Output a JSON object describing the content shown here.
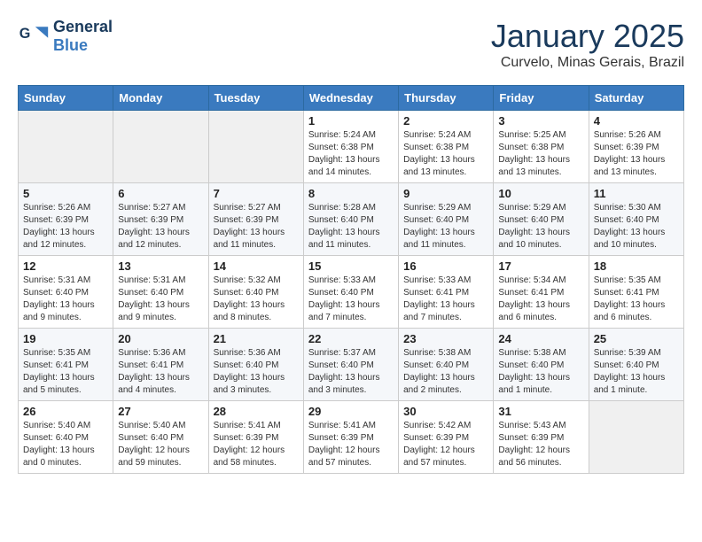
{
  "logo": {
    "line1": "General",
    "line2": "Blue"
  },
  "title": "January 2025",
  "location": "Curvelo, Minas Gerais, Brazil",
  "weekdays": [
    "Sunday",
    "Monday",
    "Tuesday",
    "Wednesday",
    "Thursday",
    "Friday",
    "Saturday"
  ],
  "weeks": [
    [
      {
        "day": "",
        "info": ""
      },
      {
        "day": "",
        "info": ""
      },
      {
        "day": "",
        "info": ""
      },
      {
        "day": "1",
        "info": "Sunrise: 5:24 AM\nSunset: 6:38 PM\nDaylight: 13 hours\nand 14 minutes."
      },
      {
        "day": "2",
        "info": "Sunrise: 5:24 AM\nSunset: 6:38 PM\nDaylight: 13 hours\nand 13 minutes."
      },
      {
        "day": "3",
        "info": "Sunrise: 5:25 AM\nSunset: 6:38 PM\nDaylight: 13 hours\nand 13 minutes."
      },
      {
        "day": "4",
        "info": "Sunrise: 5:26 AM\nSunset: 6:39 PM\nDaylight: 13 hours\nand 13 minutes."
      }
    ],
    [
      {
        "day": "5",
        "info": "Sunrise: 5:26 AM\nSunset: 6:39 PM\nDaylight: 13 hours\nand 12 minutes."
      },
      {
        "day": "6",
        "info": "Sunrise: 5:27 AM\nSunset: 6:39 PM\nDaylight: 13 hours\nand 12 minutes."
      },
      {
        "day": "7",
        "info": "Sunrise: 5:27 AM\nSunset: 6:39 PM\nDaylight: 13 hours\nand 11 minutes."
      },
      {
        "day": "8",
        "info": "Sunrise: 5:28 AM\nSunset: 6:40 PM\nDaylight: 13 hours\nand 11 minutes."
      },
      {
        "day": "9",
        "info": "Sunrise: 5:29 AM\nSunset: 6:40 PM\nDaylight: 13 hours\nand 11 minutes."
      },
      {
        "day": "10",
        "info": "Sunrise: 5:29 AM\nSunset: 6:40 PM\nDaylight: 13 hours\nand 10 minutes."
      },
      {
        "day": "11",
        "info": "Sunrise: 5:30 AM\nSunset: 6:40 PM\nDaylight: 13 hours\nand 10 minutes."
      }
    ],
    [
      {
        "day": "12",
        "info": "Sunrise: 5:31 AM\nSunset: 6:40 PM\nDaylight: 13 hours\nand 9 minutes."
      },
      {
        "day": "13",
        "info": "Sunrise: 5:31 AM\nSunset: 6:40 PM\nDaylight: 13 hours\nand 9 minutes."
      },
      {
        "day": "14",
        "info": "Sunrise: 5:32 AM\nSunset: 6:40 PM\nDaylight: 13 hours\nand 8 minutes."
      },
      {
        "day": "15",
        "info": "Sunrise: 5:33 AM\nSunset: 6:40 PM\nDaylight: 13 hours\nand 7 minutes."
      },
      {
        "day": "16",
        "info": "Sunrise: 5:33 AM\nSunset: 6:41 PM\nDaylight: 13 hours\nand 7 minutes."
      },
      {
        "day": "17",
        "info": "Sunrise: 5:34 AM\nSunset: 6:41 PM\nDaylight: 13 hours\nand 6 minutes."
      },
      {
        "day": "18",
        "info": "Sunrise: 5:35 AM\nSunset: 6:41 PM\nDaylight: 13 hours\nand 6 minutes."
      }
    ],
    [
      {
        "day": "19",
        "info": "Sunrise: 5:35 AM\nSunset: 6:41 PM\nDaylight: 13 hours\nand 5 minutes."
      },
      {
        "day": "20",
        "info": "Sunrise: 5:36 AM\nSunset: 6:41 PM\nDaylight: 13 hours\nand 4 minutes."
      },
      {
        "day": "21",
        "info": "Sunrise: 5:36 AM\nSunset: 6:40 PM\nDaylight: 13 hours\nand 3 minutes."
      },
      {
        "day": "22",
        "info": "Sunrise: 5:37 AM\nSunset: 6:40 PM\nDaylight: 13 hours\nand 3 minutes."
      },
      {
        "day": "23",
        "info": "Sunrise: 5:38 AM\nSunset: 6:40 PM\nDaylight: 13 hours\nand 2 minutes."
      },
      {
        "day": "24",
        "info": "Sunrise: 5:38 AM\nSunset: 6:40 PM\nDaylight: 13 hours\nand 1 minute."
      },
      {
        "day": "25",
        "info": "Sunrise: 5:39 AM\nSunset: 6:40 PM\nDaylight: 13 hours\nand 1 minute."
      }
    ],
    [
      {
        "day": "26",
        "info": "Sunrise: 5:40 AM\nSunset: 6:40 PM\nDaylight: 13 hours\nand 0 minutes."
      },
      {
        "day": "27",
        "info": "Sunrise: 5:40 AM\nSunset: 6:40 PM\nDaylight: 12 hours\nand 59 minutes."
      },
      {
        "day": "28",
        "info": "Sunrise: 5:41 AM\nSunset: 6:39 PM\nDaylight: 12 hours\nand 58 minutes."
      },
      {
        "day": "29",
        "info": "Sunrise: 5:41 AM\nSunset: 6:39 PM\nDaylight: 12 hours\nand 57 minutes."
      },
      {
        "day": "30",
        "info": "Sunrise: 5:42 AM\nSunset: 6:39 PM\nDaylight: 12 hours\nand 57 minutes."
      },
      {
        "day": "31",
        "info": "Sunrise: 5:43 AM\nSunset: 6:39 PM\nDaylight: 12 hours\nand 56 minutes."
      },
      {
        "day": "",
        "info": ""
      }
    ]
  ]
}
